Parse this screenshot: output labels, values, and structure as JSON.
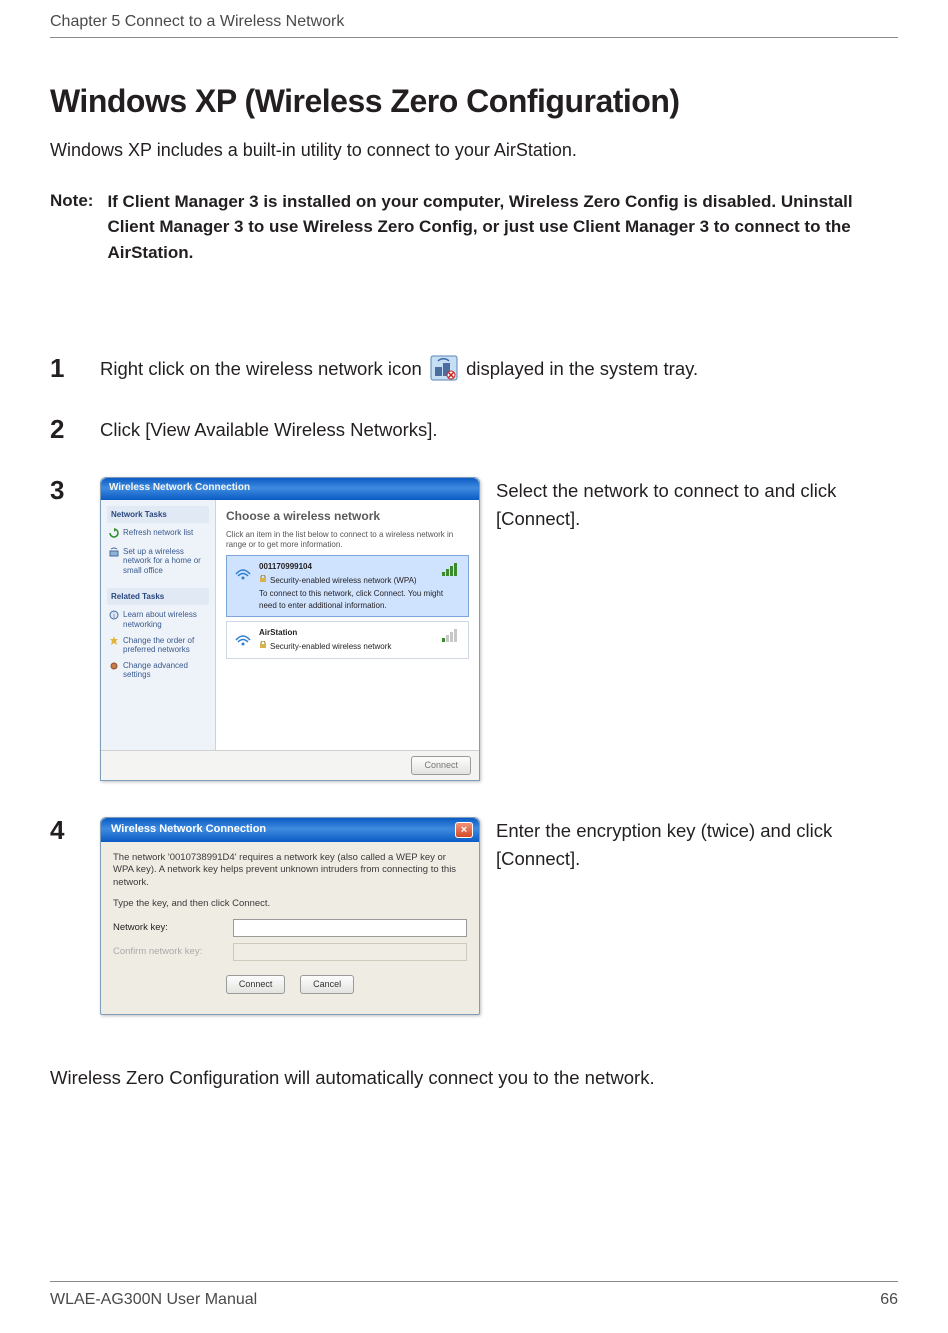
{
  "header": {
    "chapter_line": "Chapter 5  Connect to a Wireless Network"
  },
  "section_title": "Windows XP (Wireless Zero Configuration)",
  "intro_text": "Windows XP includes a built-in utility to connect to your AirStation.",
  "note": {
    "label": "Note:",
    "text": "If Client Manager 3 is installed on your computer, Wireless Zero Config is disabled. Uninstall Client Manager 3 to use Wireless Zero Config, or just use Client Manager 3 to connect to the AirStation."
  },
  "steps": {
    "s1": {
      "num": "1",
      "pre": "Right click on the wireless network icon ",
      "post": " displayed in the system tray."
    },
    "s2": {
      "num": "2",
      "text": "Click [View Available Wireless Networks]."
    },
    "s3": {
      "num": "3",
      "text": "Select the network to connect to and click [Connect]."
    },
    "s4": {
      "num": "4",
      "text": "Enter the encryption key (twice) and click [Connect]."
    }
  },
  "dlg3": {
    "title": "Wireless Network Connection",
    "side_hdr1": "Network Tasks",
    "side_item1": "Refresh network list",
    "side_item2": "Set up a wireless network for a home or small office",
    "side_hdr2": "Related Tasks",
    "side_item3": "Learn about wireless networking",
    "side_item4": "Change the order of preferred networks",
    "side_item5": "Change advanced settings",
    "main_hdr": "Choose a wireless network",
    "main_sub": "Click an item in the list below to connect to a wireless network in range or to get more information.",
    "net1_ssid": "001170999104",
    "net1_line1": "Security-enabled wireless network (WPA)",
    "net1_line2": "To connect to this network, click Connect. You might need to enter additional information.",
    "net2_ssid": "AirStation",
    "net2_line1": "Security-enabled wireless network",
    "connect_btn": "Connect"
  },
  "dlg4": {
    "title": "Wireless Network Connection",
    "p1": "The network '0010738991D4' requires a network key (also called a WEP key or WPA key). A network key helps prevent unknown intruders from connecting to this network.",
    "p2": "Type the key, and then click Connect.",
    "lbl_key": "Network key:",
    "lbl_confirm": "Confirm network key:",
    "btn_connect": "Connect",
    "btn_cancel": "Cancel"
  },
  "closing": "Wireless Zero Configuration will automatically connect you to the network.",
  "footer": {
    "manual": "WLAE-AG300N User Manual",
    "page": "66"
  }
}
